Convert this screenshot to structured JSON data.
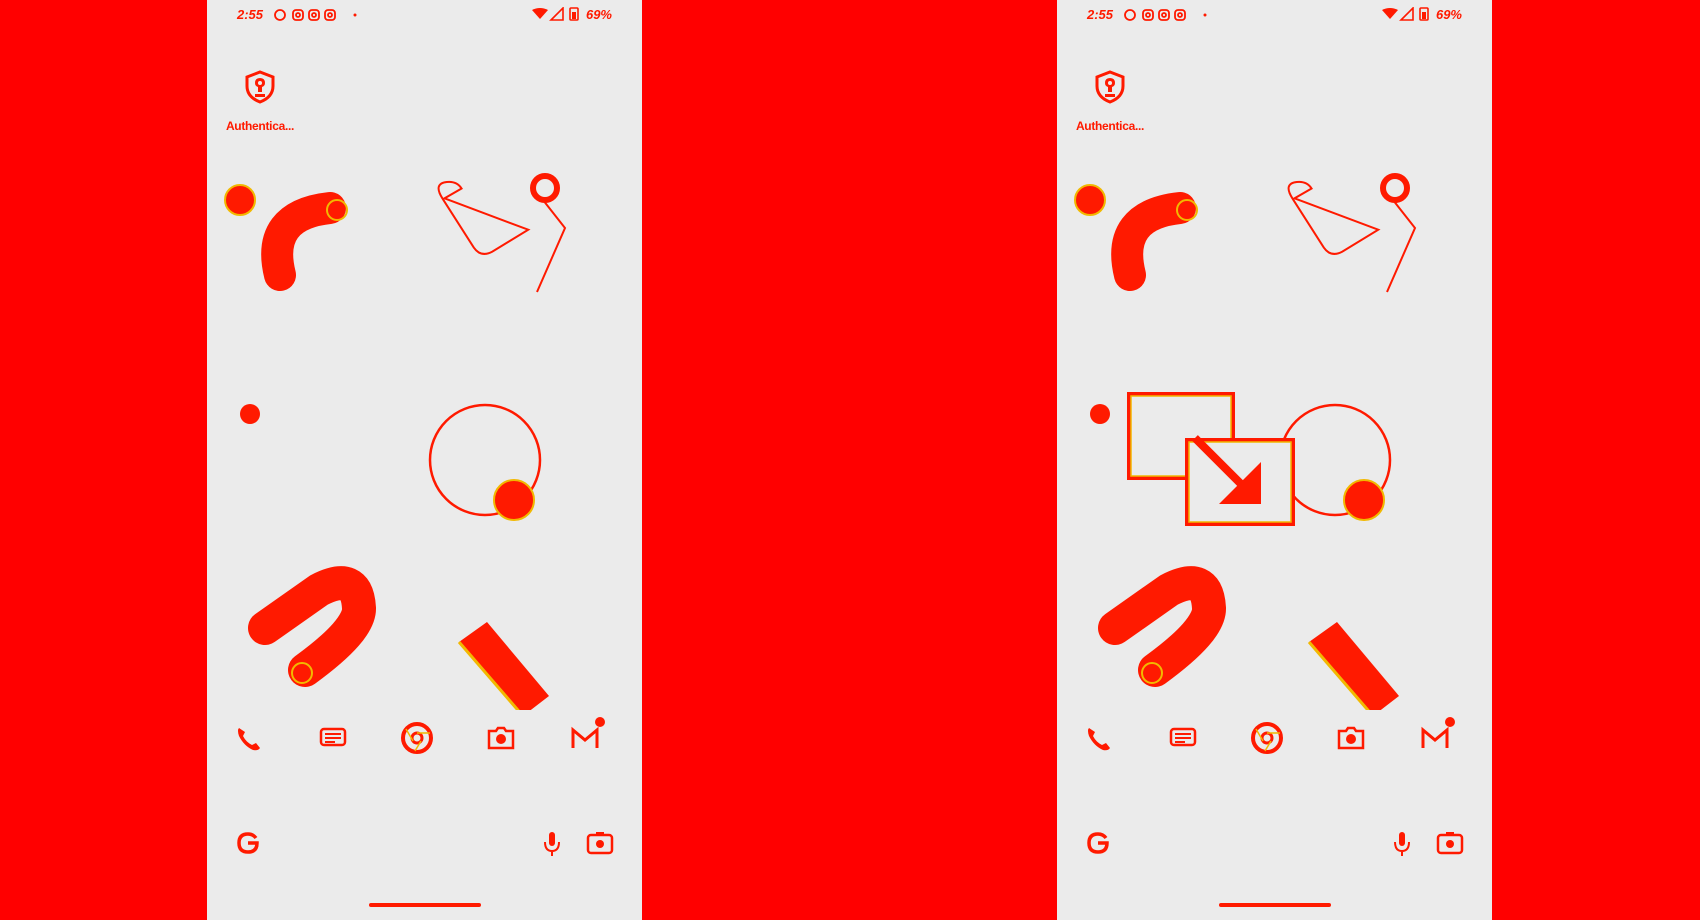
{
  "screens": [
    {
      "status_bar": {
        "time": "2:55",
        "battery": "69%"
      },
      "home_app": {
        "label": "Authentica...",
        "icon": "shield-lock-icon"
      },
      "dock": [
        {
          "name": "phone",
          "icon": "phone-icon"
        },
        {
          "name": "messages",
          "icon": "messages-icon"
        },
        {
          "name": "chrome",
          "icon": "chrome-icon"
        },
        {
          "name": "camera",
          "icon": "camera-icon"
        },
        {
          "name": "gmail",
          "icon": "gmail-icon"
        }
      ],
      "search_bar": {
        "icons": [
          "google-g-icon",
          "mic-icon",
          "lens-icon"
        ]
      },
      "overlay": null
    },
    {
      "status_bar": {
        "time": "2:55",
        "battery": "69%"
      },
      "home_app": {
        "label": "Authentica...",
        "icon": "shield-lock-icon"
      },
      "dock": [
        {
          "name": "phone",
          "icon": "phone-icon"
        },
        {
          "name": "messages",
          "icon": "messages-icon"
        },
        {
          "name": "chrome",
          "icon": "chrome-icon"
        },
        {
          "name": "camera",
          "icon": "camera-icon"
        },
        {
          "name": "gmail",
          "icon": "gmail-icon"
        }
      ],
      "search_bar": {
        "icons": [
          "google-g-icon",
          "mic-icon",
          "lens-icon"
        ]
      },
      "overlay": {
        "icon": "picture-in-picture-icon"
      }
    }
  ],
  "colors": {
    "background": "#ff0000",
    "screen": "#ebebeb",
    "accent": "#ff1a00",
    "highlight": "#f2b800"
  }
}
